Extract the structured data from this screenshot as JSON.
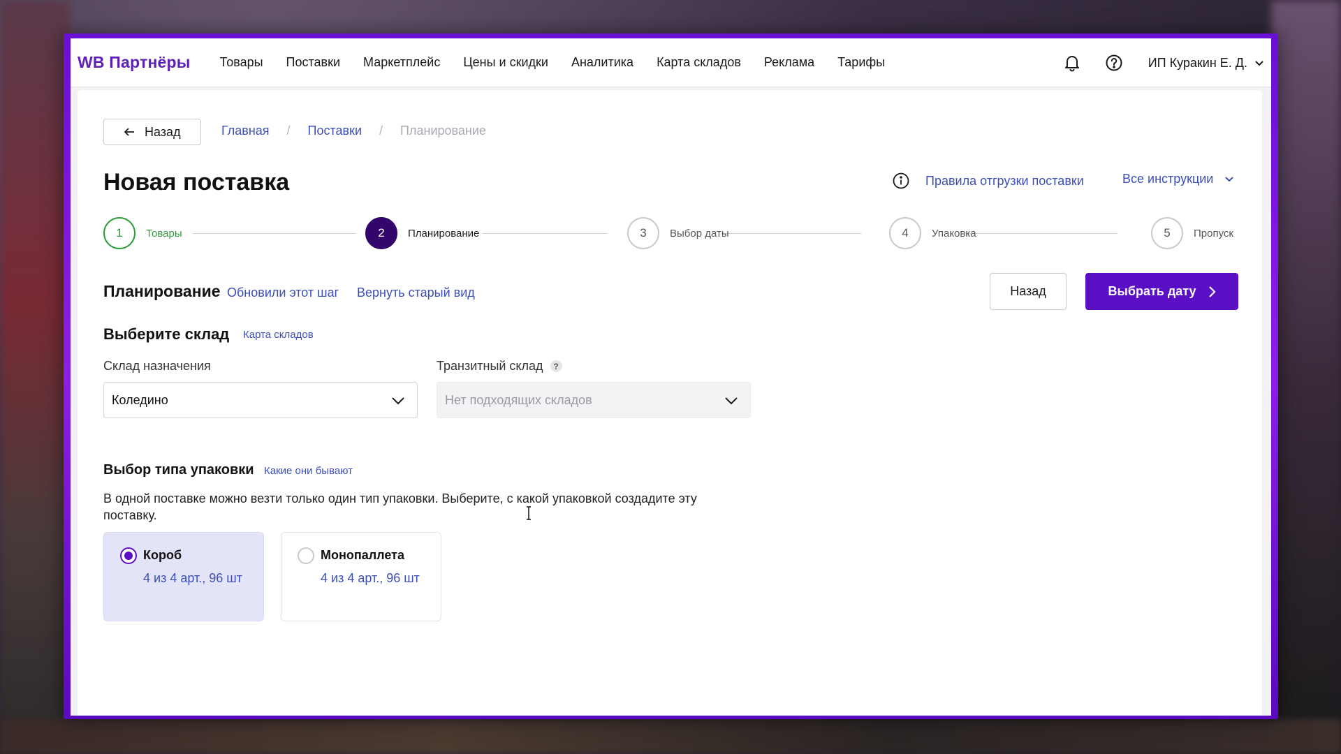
{
  "nav": {
    "logo": "WB Партнёры",
    "items": [
      "Товары",
      "Поставки",
      "Маркетплейс",
      "Цены и скидки",
      "Аналитика",
      "Карта складов",
      "Реклама",
      "Тарифы"
    ],
    "user": "ИП Куракин Е. Д."
  },
  "breadcrumb": {
    "back": "Назад",
    "items": [
      "Главная",
      "Поставки",
      "Планирование"
    ]
  },
  "page": {
    "title": "Новая поставка",
    "rules_link": "Правила отгрузки поставки",
    "all_instructions": "Все инструкции"
  },
  "stepper": [
    {
      "num": "1",
      "label": "Товары",
      "state": "done"
    },
    {
      "num": "2",
      "label": "Планирование",
      "state": "active"
    },
    {
      "num": "3",
      "label": "Выбор даты",
      "state": "todo"
    },
    {
      "num": "4",
      "label": "Упаковка",
      "state": "todo"
    },
    {
      "num": "5",
      "label": "Пропуск",
      "state": "todo"
    }
  ],
  "section": {
    "title": "Планирование",
    "link_updated": "Обновили этот шаг",
    "link_old_view": "Вернуть старый вид",
    "btn_back": "Назад",
    "btn_next": "Выбрать дату"
  },
  "warehouse": {
    "title": "Выберите склад",
    "map_link": "Карта складов",
    "dest_label": "Склад назначения",
    "dest_value": "Коледино",
    "transit_label": "Транзитный склад",
    "transit_help": "?",
    "transit_value": "Нет подходящих складов"
  },
  "packaging": {
    "title": "Выбор типа упаковки",
    "link": "Какие они бывают",
    "description": "В одной поставке можно везти только один тип упаковки. Выберите, с какой упаковкой создадите эту поставку.",
    "options": [
      {
        "name": "Короб",
        "meta": "4 из 4 арт., 96 шт",
        "selected": true
      },
      {
        "name": "Монопаллета",
        "meta": "4 из 4 арт., 96 шт",
        "selected": false
      }
    ]
  },
  "colors": {
    "brand": "#5b0fc5",
    "link": "#3c4fb8",
    "success": "#2e9b3a",
    "active_step": "#33066b"
  },
  "icons": {
    "bell": "bell-icon",
    "help": "help-circle-icon",
    "info": "info-icon",
    "back_arrow": "arrow-left-icon",
    "chevron": "chevron-down-icon",
    "next": "chevron-right-icon"
  }
}
